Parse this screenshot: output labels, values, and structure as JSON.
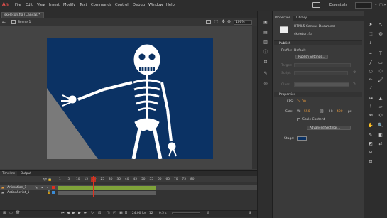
{
  "app": {
    "logo_text": "An",
    "menu": [
      "File",
      "Edit",
      "View",
      "Insert",
      "Modify",
      "Text",
      "Commands",
      "Control",
      "Debug",
      "Window",
      "Help"
    ],
    "workspace": "Essentials",
    "window_controls": [
      "–",
      "□",
      "✕"
    ]
  },
  "document": {
    "tab_label": "skeleton.fla (Canvas)*",
    "scene": "Scene 1",
    "zoom": "100%"
  },
  "colors": {
    "stage_bg": "#0b3264",
    "accent_red": "#e5504d",
    "frames_green": "#7fa33a",
    "playhead": "#e0301e",
    "value_orange": "#e99a3d"
  },
  "properties_panel": {
    "tabs": [
      "Properties",
      "Library"
    ],
    "doc_type": "HTML5 Canvas Document",
    "file_name": "skeleton.fla",
    "publish": {
      "section": "Publish",
      "profile_label": "Profile:",
      "profile_value": "Default",
      "publish_settings_button": "Publish Settings...",
      "target_label": "Target:",
      "script_label": "Script:",
      "class_label": "Class:"
    },
    "properties": {
      "section": "Properties",
      "fps_label": "FPS:",
      "fps_value": "24.00",
      "size_label": "Size:",
      "w_label": "W:",
      "w_value": "550",
      "h_label": "H:",
      "h_value": "400",
      "px_label": "px",
      "scale_content": "Scale Content",
      "advanced_button": "Advanced Settings...",
      "stage_label": "Stage:"
    }
  },
  "timeline": {
    "tabs": [
      "Timeline",
      "Output"
    ],
    "frame_numbers": [
      "1",
      "5",
      "10",
      "15",
      "20",
      "25",
      "30",
      "35",
      "40",
      "45",
      "50",
      "55",
      "60",
      "65",
      "70",
      "75",
      "80"
    ],
    "layers": [
      {
        "name": "Animation_1"
      },
      {
        "name": "ActionScript_1"
      }
    ],
    "fps_display": "24.00 fps",
    "frame_display": "12",
    "time_display": "0.5 s"
  }
}
